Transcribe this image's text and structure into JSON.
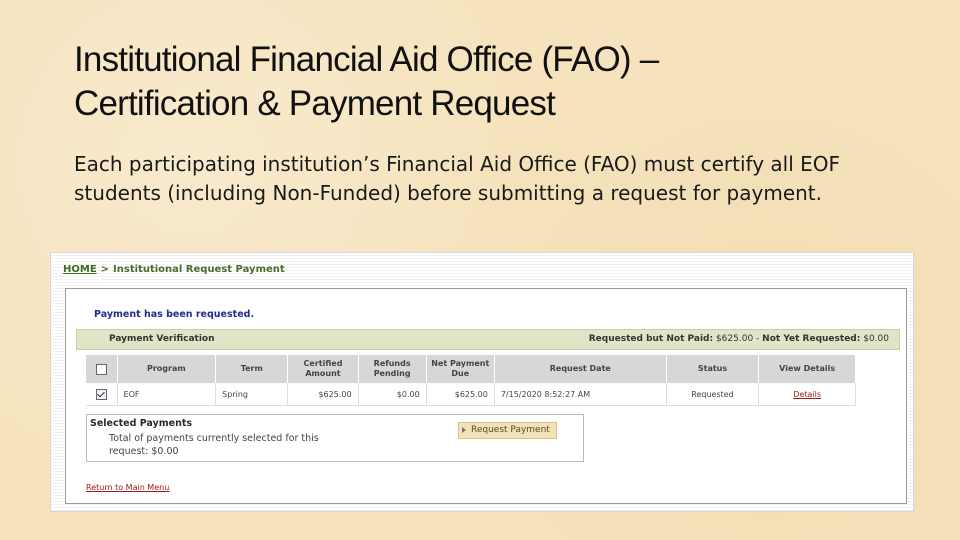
{
  "slide": {
    "title_line1": "Institutional Financial Aid Office (FAO) –",
    "title_line2": "Certification & Payment Request",
    "body": "Each participating institution’s Financial Aid Office (FAO) must certify all EOF students (including Non-Funded) before submitting a request for payment."
  },
  "breadcrumb": {
    "home": "HOME",
    "separator": ">",
    "current": "Institutional Request Payment"
  },
  "message": "Payment has been requested.",
  "verification": {
    "label": "Payment Verification",
    "requested_not_paid_label": "Requested but Not Paid:",
    "requested_not_paid_value": "$625.00",
    "dash": "-",
    "not_yet_requested_label": "Not Yet Requested:",
    "not_yet_requested_value": "$0.00"
  },
  "table": {
    "headers": [
      "Program",
      "Term",
      "Certified Amount",
      "Refunds Pending",
      "Net Payment Due",
      "Request Date",
      "Status",
      "View Details"
    ],
    "rows": [
      {
        "checked": true,
        "program": "EOF",
        "term": "Spring",
        "certified": "$625.00",
        "refunds": "$0.00",
        "net": "$625.00",
        "date": "7/15/2020 8:52:27 AM",
        "status": "Requested",
        "details": "Details"
      }
    ]
  },
  "selected": {
    "legend": "Selected Payments",
    "total": "Total of payments currently selected for this request: $0.00",
    "button": "Request Payment"
  },
  "return_link": "Return to Main Menu",
  "icons": {
    "checkbox": "checkbox-icon",
    "button_arrow": "arrow-right-icon"
  }
}
